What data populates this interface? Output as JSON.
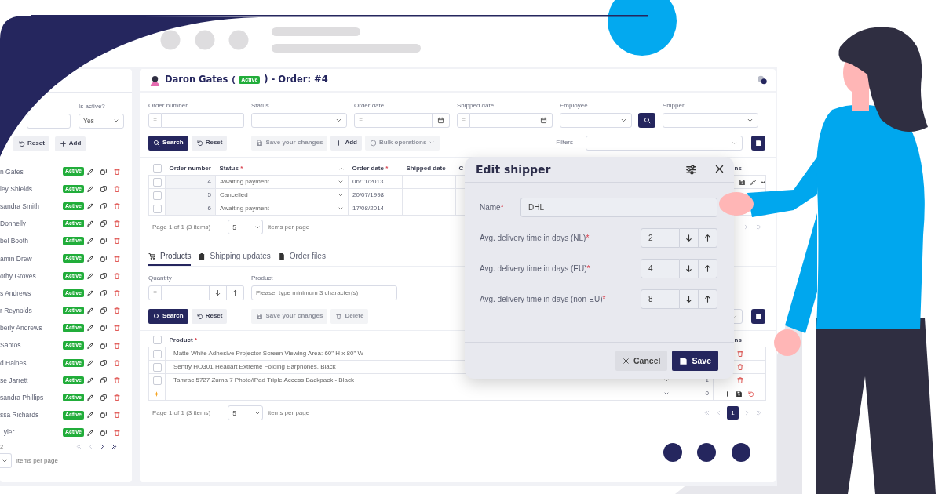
{
  "people_panel": {
    "filter": {
      "label": "Is active?",
      "value": "Yes"
    },
    "buttons": [
      {
        "label": "Reset",
        "kind": "reset"
      },
      {
        "label": "Add",
        "kind": "add"
      }
    ],
    "rows": [
      {
        "name": "n Gates",
        "status": "Active"
      },
      {
        "name": "ley Shields",
        "status": "Active"
      },
      {
        "name": "sandra Smith",
        "status": "Active"
      },
      {
        "name": "Donnelly",
        "status": "Active"
      },
      {
        "name": "bel Booth",
        "status": "Active"
      },
      {
        "name": "amin Drew",
        "status": "Active"
      },
      {
        "name": "othy Groves",
        "status": "Active"
      },
      {
        "name": "s Andrews",
        "status": "Active"
      },
      {
        "name": "r Reynolds",
        "status": "Active"
      },
      {
        "name": "berly Andrews",
        "status": "Active"
      },
      {
        "name": "Santos",
        "status": "Active"
      },
      {
        "name": "d Haines",
        "status": "Active"
      },
      {
        "name": "se Jarrett",
        "status": "Active"
      },
      {
        "name": "sandra Phillips",
        "status": "Active"
      },
      {
        "name": "ssa Richards",
        "status": "Active"
      },
      {
        "name": "Tyler",
        "status": "Active"
      }
    ],
    "pager": {
      "info": "2",
      "items_per_page": "items per page",
      "can_go_back": false
    }
  },
  "order_view": {
    "header": {
      "name": "Daron Gates",
      "open": "(",
      "status": "Active",
      "close": ")",
      "order": "- Order: #4"
    },
    "filters": [
      {
        "label": "Order number",
        "kind": "operator",
        "operator": "="
      },
      {
        "label": "Status",
        "kind": "select"
      },
      {
        "label": "Order date",
        "kind": "date",
        "operator": "="
      },
      {
        "label": "Shipped date",
        "kind": "date",
        "operator": "="
      },
      {
        "label": "Employee",
        "kind": "lookup"
      },
      {
        "label": "Shipper",
        "kind": "select"
      }
    ],
    "toolbar": [
      {
        "label": "Search",
        "kind": "search",
        "disabled": false
      },
      {
        "label": "Reset",
        "kind": "reset",
        "disabled": false
      },
      {
        "label": "Save your changes",
        "kind": "save",
        "disabled": true
      },
      {
        "label": "Add",
        "kind": "add",
        "disabled": false
      },
      {
        "label": "Bulk operations",
        "kind": "bulk",
        "disabled": true
      }
    ],
    "saved_filters": {
      "label": "Filters"
    },
    "orders": {
      "header_checked": false,
      "columns": [
        {
          "label": "Order number"
        },
        {
          "label": "Status",
          "required_mark": "*"
        },
        {
          "label": "Order date",
          "required_mark": "*"
        },
        {
          "label": "Shipped date"
        },
        {
          "label": "C"
        },
        {
          "label": "ns"
        }
      ],
      "rows": [
        {
          "checked": false,
          "number": "4",
          "status": "Awaiting payment",
          "order_date": "06/11/2013"
        },
        {
          "checked": false,
          "number": "5",
          "status": "Cancelled",
          "order_date": "20/07/1998"
        },
        {
          "checked": false,
          "number": "6",
          "status": "Awaiting payment",
          "order_date": "17/08/2014"
        }
      ],
      "pager": {
        "info": "Page 1 of 1 (3 items)",
        "page_size": "5",
        "items_per_page": "items per page"
      }
    },
    "tabs": [
      {
        "label": "Products",
        "selected": true
      },
      {
        "label": "Shipping updates",
        "selected": false
      },
      {
        "label": "Order files",
        "selected": false
      }
    ],
    "product_filters": [
      {
        "label": "Quantity",
        "kind": "number",
        "operator": "="
      },
      {
        "label": "Product",
        "kind": "text",
        "placeholder": "Please, type minimum 3 character(s)"
      }
    ],
    "product_toolbar": [
      {
        "label": "Search",
        "kind": "search",
        "disabled": false
      },
      {
        "label": "Reset",
        "kind": "reset",
        "disabled": false
      },
      {
        "label": "Save your changes",
        "kind": "save",
        "disabled": true
      },
      {
        "label": "Delete",
        "kind": "delete",
        "disabled": true
      }
    ],
    "products": {
      "header_checked": false,
      "columns": [
        {
          "label": "Product",
          "required_mark": "*"
        },
        {
          "label": "ns"
        }
      ],
      "rows": [
        {
          "checked": false,
          "product": "Matte White Adhesive Projector Screen Viewing Area: 60\" H x 80\" W"
        },
        {
          "checked": false,
          "product": "Sentry HO301 Headart Extreme Folding Earphones, Black"
        },
        {
          "checked": false,
          "product": "Tamrac 5727 Zuma 7 Photo/iPad Triple Access Backpack - Black",
          "quantity": "1"
        }
      ],
      "new_row": {
        "quantity": "0"
      },
      "pager": {
        "info": "Page 1 of 1 (3 items)",
        "page_size": "5",
        "items_per_page": "items per page",
        "current_page": "1"
      }
    }
  },
  "dialog": {
    "title": "Edit shipper",
    "fields": [
      {
        "label": "Name",
        "required_mark": "*",
        "kind": "text",
        "value": "DHL"
      },
      {
        "label": "Avg. delivery time in days (NL)",
        "required_mark": "*",
        "kind": "number",
        "value": "2"
      },
      {
        "label": "Avg. delivery time in days (EU)",
        "required_mark": "*",
        "kind": "number",
        "value": "4"
      },
      {
        "label": "Avg. delivery time in days (non-EU)",
        "required_mark": "*",
        "kind": "number",
        "value": "8"
      }
    ],
    "buttons": [
      {
        "label": "Cancel",
        "kind": "cancel"
      },
      {
        "label": "Save",
        "kind": "save"
      }
    ]
  }
}
